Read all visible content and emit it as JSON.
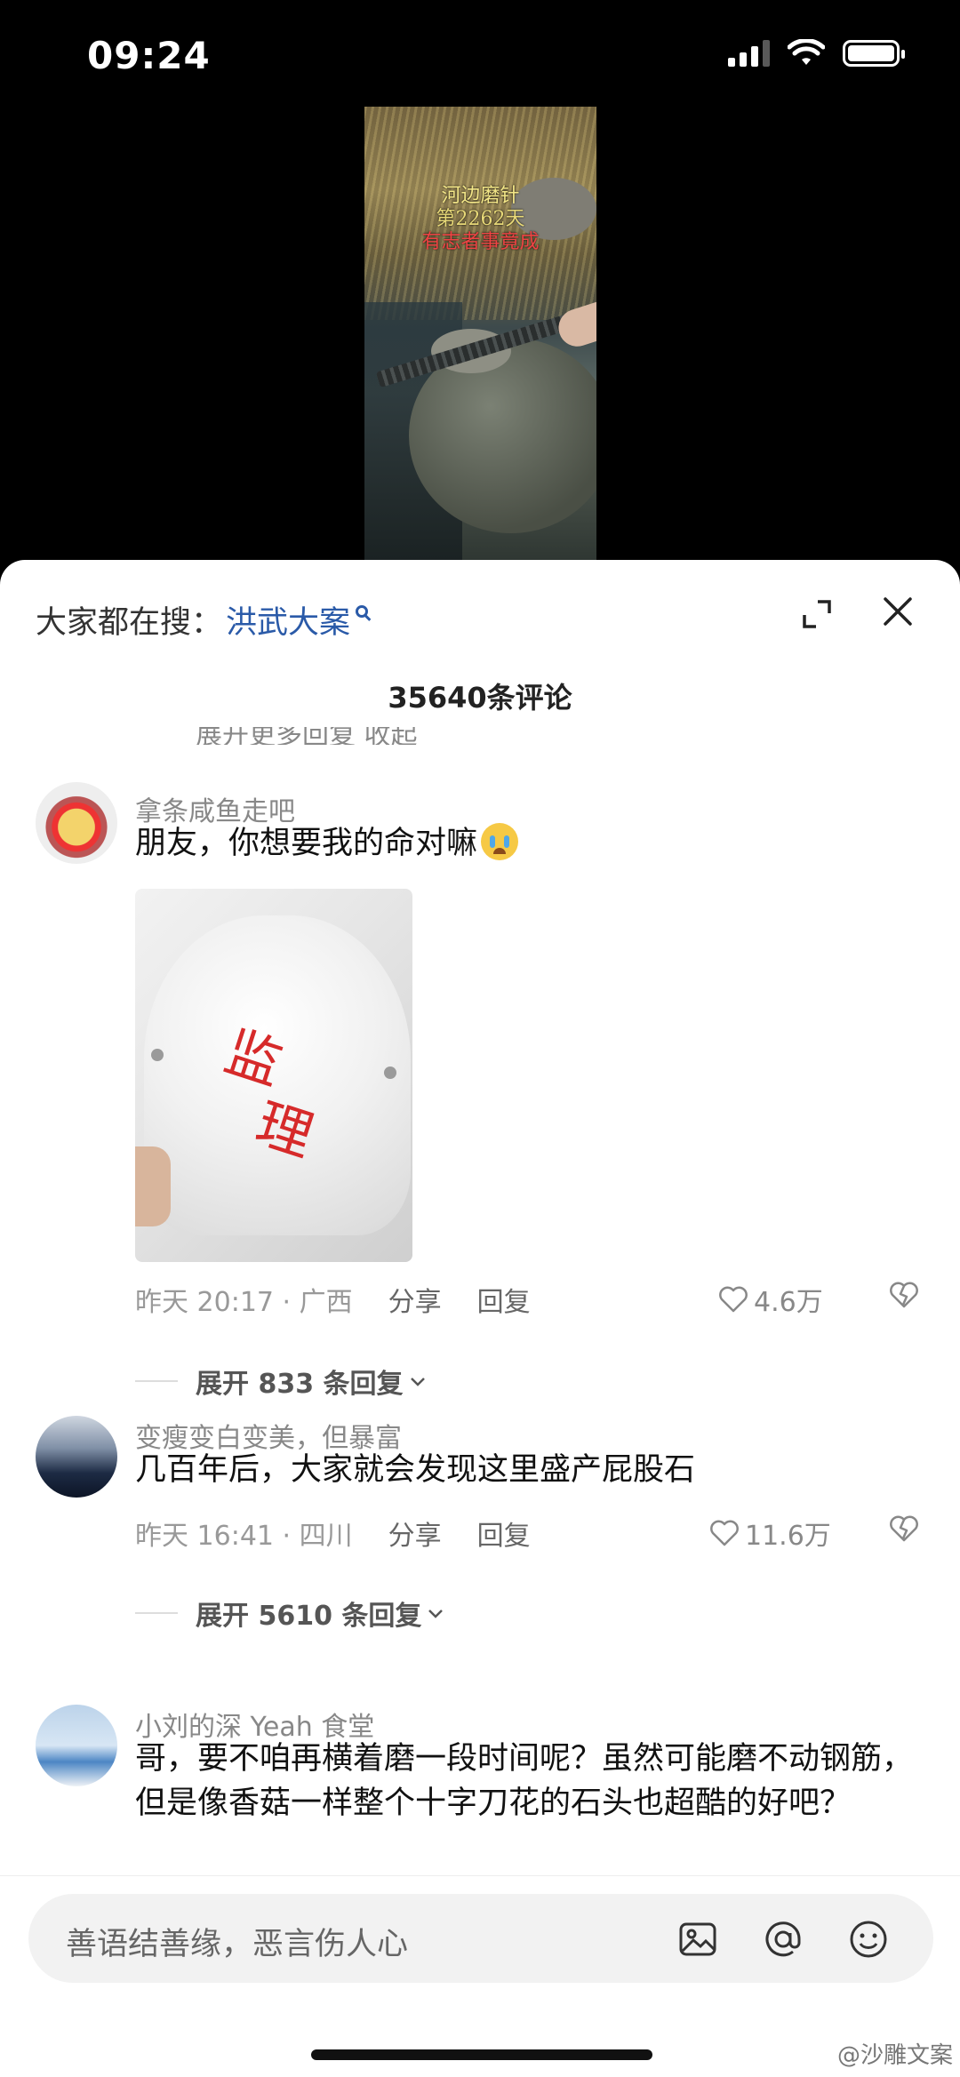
{
  "status_bar": {
    "time": "09:24"
  },
  "video": {
    "overlay_lines": [
      "河边磨针",
      "第2262天",
      "有志者事竟成"
    ]
  },
  "sheet": {
    "search_prefix": "大家都在搜：",
    "search_term": "洪武大案",
    "comment_count_title": "35640条评论",
    "cutoff_text": "展开更多回复      收起"
  },
  "comments": [
    {
      "user": "拿条咸鱼走吧",
      "text": "朋友，你想要我的命对嘛",
      "image_text": [
        "监",
        "理"
      ],
      "time_location": "昨天 20:17 · 广西",
      "share": "分享",
      "reply": "回复",
      "likes": "4.6万",
      "expand": "展开 833 条回复"
    },
    {
      "user": "变瘦变白变美，但暴富",
      "text": "几百年后，大家就会发现这里盛产屁股石",
      "time_location": "昨天 16:41 · 四川",
      "share": "分享",
      "reply": "回复",
      "likes": "11.6万",
      "expand": "展开 5610 条回复"
    },
    {
      "user": "小刘的深 Yeah 食堂",
      "text": "哥，要不咱再横着磨一段时间呢？虽然可能磨不动钢筋，但是像香菇一样整个十字刀花的石头也超酷的好吧？"
    }
  ],
  "input": {
    "placeholder": "善语结善缘，恶言伤人心"
  },
  "watermark": "@沙雕文案",
  "icons": [
    "search-icon",
    "expand-icon",
    "close-icon",
    "heart-icon",
    "dislike-icon",
    "chevron-down-icon",
    "image-icon",
    "at-icon",
    "emoji-icon"
  ]
}
